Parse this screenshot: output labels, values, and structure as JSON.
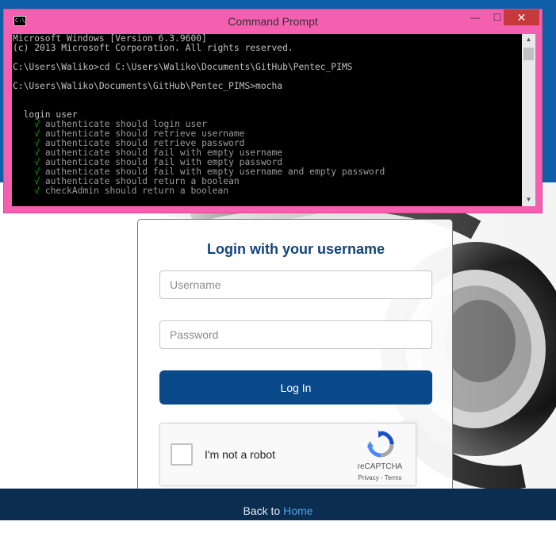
{
  "cmd_window": {
    "title": "Command Prompt",
    "minimize_icon": "—",
    "maximize_icon": "☐",
    "close_icon": "✕",
    "lines": [
      {
        "type": "text",
        "text": "Microsoft Windows [Version 6.3.9600]"
      },
      {
        "type": "text",
        "text": "(c) 2013 Microsoft Corporation. All rights reserved."
      },
      {
        "type": "blank",
        "text": ""
      },
      {
        "type": "text",
        "text": "C:\\Users\\Waliko>cd C:\\Users\\Waliko\\Documents\\GitHub\\Pentec_PIMS"
      },
      {
        "type": "blank",
        "text": ""
      },
      {
        "type": "text",
        "text": "C:\\Users\\Waliko\\Documents\\GitHub\\Pentec_PIMS>mocha"
      },
      {
        "type": "blank",
        "text": ""
      },
      {
        "type": "blank",
        "text": ""
      },
      {
        "type": "text",
        "text": "  login user"
      },
      {
        "type": "pass",
        "text": "authenticate should login user"
      },
      {
        "type": "pass",
        "text": "authenticate should retrieve username"
      },
      {
        "type": "pass",
        "text": "authenticate should retrieve password"
      },
      {
        "type": "pass",
        "text": "authenticate should fail with empty username"
      },
      {
        "type": "pass",
        "text": "authenticate should fail with empty password"
      },
      {
        "type": "pass",
        "text": "authenticate should fail with empty username and empty password"
      },
      {
        "type": "pass",
        "text": "authenticate should return a boolean"
      },
      {
        "type": "pass",
        "text": "checkAdmin should return a boolean"
      }
    ],
    "pass_mark": "√"
  },
  "login": {
    "title": "Login with your username",
    "username_placeholder": "Username",
    "password_placeholder": "Password",
    "button_label": "Log In"
  },
  "recaptcha": {
    "label": "I'm not a robot",
    "brand": "reCAPTCHA",
    "privacy": "Privacy",
    "separator": " - ",
    "terms": "Terms"
  },
  "footer": {
    "prefix": "Back to ",
    "link": "Home"
  },
  "colors": {
    "header_band": "#0f5ea8",
    "login_button": "#0b4a8a",
    "footer": "#0b2d4f",
    "cmd_frame": "#f45fb0"
  }
}
